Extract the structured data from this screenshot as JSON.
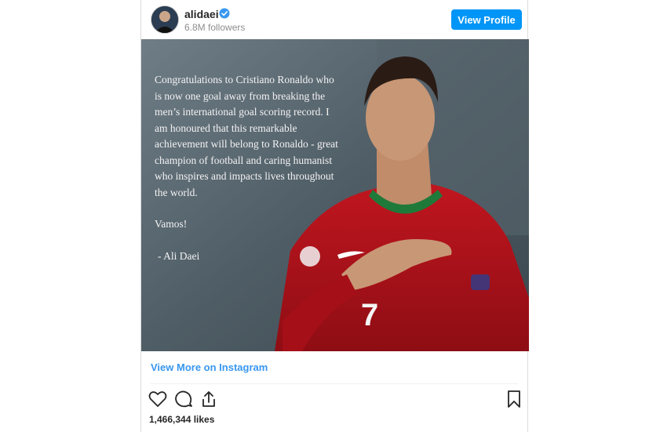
{
  "post": {
    "username": "alidaei",
    "followers": "6.8M followers",
    "view_profile_label": "View Profile",
    "image_text": {
      "paragraph1": "Congratulations to Cristiano Ronaldo who is now one goal away from breaking the men’s international goal scoring record. I am honoured that this remarkable achievement will belong to Ronaldo - great champion of football and caring humanist who inspires and impacts lives throughout the world.",
      "paragraph2": "Vamos!",
      "signature": "- Ali Daei"
    },
    "jersey_number": "7",
    "view_more_label": "View More on Instagram",
    "likes": "1,466,344 likes"
  },
  "icons": [
    "heart-icon",
    "comment-icon",
    "share-icon",
    "bookmark-icon",
    "verified-icon"
  ],
  "colors": {
    "accent": "#0095f6",
    "link": "#3897f0",
    "jersey": "#b5121b"
  }
}
